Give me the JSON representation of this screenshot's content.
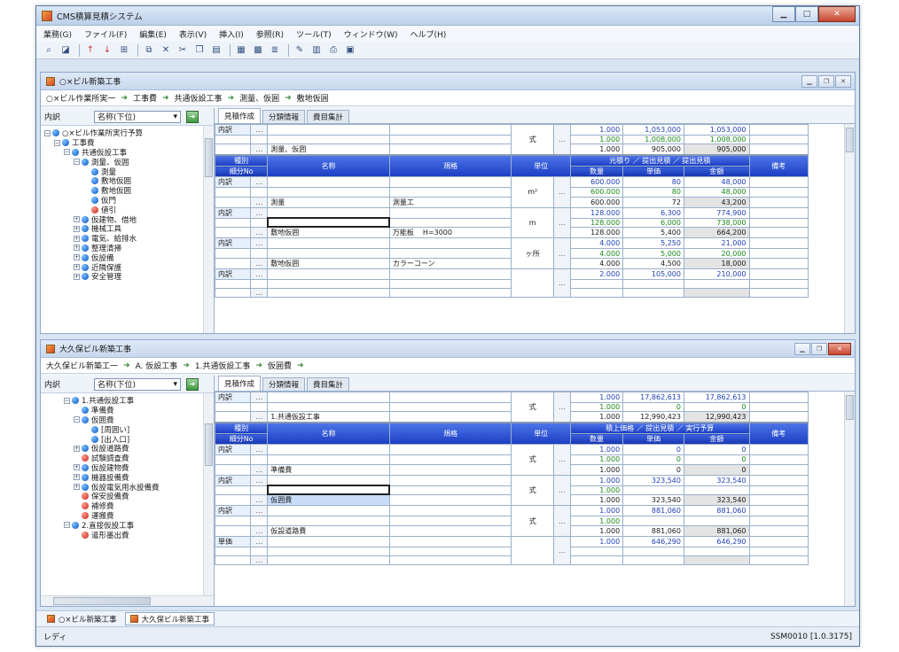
{
  "window": {
    "title": "CMS積算見積システム"
  },
  "menu": [
    "業務(G)",
    "ファイル(F)",
    "編集(E)",
    "表示(V)",
    "挿入(I)",
    "参照(R)",
    "ツール(T)",
    "ウィンドウ(W)",
    "ヘルプ(H)"
  ],
  "top": {
    "title": "○×ビル新築工事",
    "breadcrumb": [
      "○×ビル作業所実一",
      "工事費",
      "共通仮設工事",
      "測量、仮囲",
      "敷地仮囲"
    ],
    "left_label": "内訳",
    "sort_value": "名称(下位)",
    "tree": [
      {
        "indent": 0,
        "pm": "−",
        "dot": "blue",
        "label": "○×ビル作業所実行予算"
      },
      {
        "indent": 1,
        "pm": "−",
        "dot": "blue",
        "label": "工事費"
      },
      {
        "indent": 2,
        "pm": "−",
        "dot": "blue",
        "label": "共通仮設工事"
      },
      {
        "indent": 3,
        "pm": "−",
        "dot": "blue",
        "label": "測量、仮囲"
      },
      {
        "indent": 4,
        "pm": "",
        "dot": "blue",
        "label": "測量"
      },
      {
        "indent": 4,
        "pm": "",
        "dot": "blue",
        "label": "敷地仮囲"
      },
      {
        "indent": 4,
        "pm": "",
        "dot": "blue",
        "label": "敷地仮囲"
      },
      {
        "indent": 4,
        "pm": "",
        "dot": "blue",
        "label": "仮門"
      },
      {
        "indent": 4,
        "pm": "",
        "dot": "red",
        "label": "値引"
      },
      {
        "indent": 3,
        "pm": "+",
        "dot": "blue",
        "label": "仮建物、借地"
      },
      {
        "indent": 3,
        "pm": "+",
        "dot": "blue",
        "label": "機械工具"
      },
      {
        "indent": 3,
        "pm": "+",
        "dot": "blue",
        "label": "電気、給排水"
      },
      {
        "indent": 3,
        "pm": "+",
        "dot": "blue",
        "label": "整理清掃"
      },
      {
        "indent": 3,
        "pm": "+",
        "dot": "blue",
        "label": "仮設備"
      },
      {
        "indent": 3,
        "pm": "+",
        "dot": "blue",
        "label": "近隣保護"
      },
      {
        "indent": 3,
        "pm": "+",
        "dot": "blue",
        "label": "安全管理"
      }
    ],
    "tabs": [
      "見積作成",
      "分類情報",
      "費目集計"
    ],
    "summary": {
      "tag": "内訳",
      "name": "測量、仮囲",
      "unit": "式",
      "qty": [
        "1.000",
        "1.000",
        "1.000"
      ],
      "price": [
        "1,053,000",
        "1,008,000",
        "905,000"
      ],
      "amount": [
        "1,053,000",
        "1,008,000",
        "905,000"
      ]
    },
    "header": {
      "col1_top": "種別",
      "col1_bottom": "細分No",
      "name": "名称",
      "spec": "規格",
      "unit": "単位",
      "group": "元積り ／ 提出見積 ／ 提出見積",
      "qty": "数量",
      "price": "単価",
      "amount": "金額",
      "note": "備考"
    },
    "rows": [
      {
        "tag": "内訳",
        "name": "測量",
        "spec": "測量工",
        "spec2": "",
        "unit": "m²",
        "qty": [
          "600.000",
          "600.000",
          "600.000"
        ],
        "price": [
          "80",
          "80",
          "72"
        ],
        "amount": [
          "48,000",
          "48,000",
          "43,200"
        ]
      },
      {
        "tag": "内訳",
        "name": "敷地仮囲",
        "spec": "万能板",
        "spec2": "H=3000",
        "unit": "m",
        "qty": [
          "128.000",
          "128.000",
          "128.000"
        ],
        "price": [
          "6,300",
          "6,000",
          "5,400"
        ],
        "amount": [
          "774,900",
          "738,000",
          "664,200"
        ]
      },
      {
        "tag": "内訳",
        "name": "敷地仮囲",
        "spec": "カラーコーン",
        "spec2": "",
        "unit": "ヶ所",
        "qty": [
          "4.000",
          "4.000",
          "4.000"
        ],
        "price": [
          "5,250",
          "5,000",
          "4,500"
        ],
        "amount": [
          "21,000",
          "20,000",
          "18,000"
        ]
      },
      {
        "tag": "内訳",
        "name": "",
        "spec": "",
        "spec2": "",
        "unit": "",
        "qty": [
          "2.000",
          "",
          ""
        ],
        "price": [
          "105,000",
          "",
          ""
        ],
        "amount": [
          "210,000",
          "",
          ""
        ]
      }
    ]
  },
  "bottom": {
    "title": "大久保ビル新築工事",
    "breadcrumb": [
      "大久保ビル新築工一",
      "A. 仮設工事",
      "1.共通仮設工事",
      "仮囲費",
      ""
    ],
    "left_label": "内訳",
    "sort_value": "名称(下位)",
    "tree": [
      {
        "indent": 2,
        "pm": "−",
        "dot": "blue",
        "label": "1.共通仮設工事"
      },
      {
        "indent": 3,
        "pm": "",
        "dot": "blue",
        "label": "準備費"
      },
      {
        "indent": 3,
        "pm": "−",
        "dot": "blue",
        "label": "仮囲費"
      },
      {
        "indent": 4,
        "pm": "",
        "dot": "blue",
        "label": "[周囲い]"
      },
      {
        "indent": 4,
        "pm": "",
        "dot": "blue",
        "label": "[出入口]"
      },
      {
        "indent": 3,
        "pm": "+",
        "dot": "blue",
        "label": "仮設道路費"
      },
      {
        "indent": 3,
        "pm": "",
        "dot": "red",
        "label": "試験調査費"
      },
      {
        "indent": 3,
        "pm": "+",
        "dot": "blue",
        "label": "仮設建物費"
      },
      {
        "indent": 3,
        "pm": "+",
        "dot": "blue",
        "label": "機器設備費"
      },
      {
        "indent": 3,
        "pm": "+",
        "dot": "blue",
        "label": "仮設電気用水設備費"
      },
      {
        "indent": 3,
        "pm": "",
        "dot": "red",
        "label": "保安設備費"
      },
      {
        "indent": 3,
        "pm": "",
        "dot": "red",
        "label": "補修費"
      },
      {
        "indent": 3,
        "pm": "",
        "dot": "red",
        "label": "運搬費"
      },
      {
        "indent": 2,
        "pm": "−",
        "dot": "blue",
        "label": "2.直接仮設工事"
      },
      {
        "indent": 3,
        "pm": "",
        "dot": "red",
        "label": "遣形墨出費"
      }
    ],
    "tabs": [
      "見積作成",
      "分類情報",
      "費目集計"
    ],
    "summary": {
      "tag": "内訳",
      "name": "1.共通仮設工事",
      "unit": "式",
      "qty": [
        "1.000",
        "1.000",
        "1.000"
      ],
      "price": [
        "17,862,613",
        "0",
        "12,990,423"
      ],
      "amount": [
        "17,862,613",
        "0",
        "12,990,423"
      ]
    },
    "header": {
      "col1_top": "種別",
      "col1_bottom": "細分No",
      "name": "名称",
      "spec": "規格",
      "unit": "単位",
      "group": "積上価格 ／ 提出見積 ／ 実行予算",
      "qty": "数量",
      "price": "単価",
      "amount": "金額",
      "note": "備考"
    },
    "rows": [
      {
        "tag": "内訳",
        "name": "準備費",
        "spec": "",
        "spec2": "",
        "unit": "式",
        "qty": [
          "1.000",
          "1.000",
          "1.000"
        ],
        "price": [
          "0",
          "0",
          "0"
        ],
        "amount": [
          "0",
          "0",
          "0"
        ]
      },
      {
        "tag": "内訳",
        "name": "仮囲費",
        "spec": "",
        "spec2": "",
        "unit": "式",
        "qty": [
          "1.000",
          "1.000",
          "1.000"
        ],
        "price": [
          "323,540",
          "",
          "323,540"
        ],
        "amount": [
          "323,540",
          "",
          "323,540"
        ]
      },
      {
        "tag": "内訳",
        "name": "仮設道路費",
        "spec": "",
        "spec2": "",
        "unit": "式",
        "qty": [
          "1.000",
          "1.000",
          "1.000"
        ],
        "price": [
          "881,060",
          "",
          "881,060"
        ],
        "amount": [
          "881,060",
          "",
          "881,060"
        ]
      },
      {
        "tag": "単価",
        "name": "",
        "spec": "",
        "spec2": "",
        "unit": "",
        "qty": [
          "1.000",
          "",
          ""
        ],
        "price": [
          "646,290",
          "",
          ""
        ],
        "amount": [
          "646,290",
          "",
          ""
        ]
      }
    ]
  },
  "taskbar": [
    "○×ビル新築工事",
    "大久保ビル新築工事"
  ],
  "status": {
    "left": "レディ",
    "right": "SSM0010 [1.0.3175]"
  }
}
